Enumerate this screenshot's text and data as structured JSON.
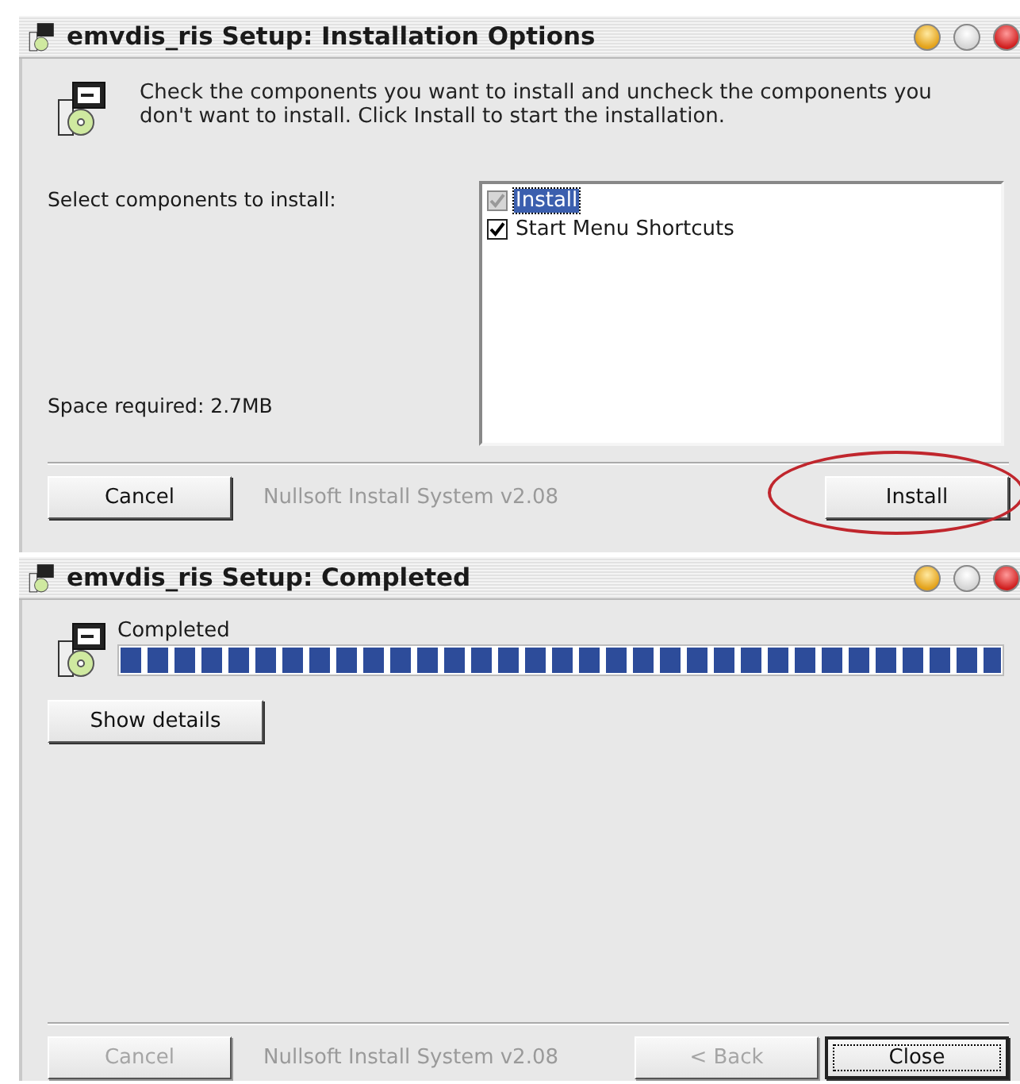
{
  "windows": [
    {
      "kind": "options",
      "title": "emvdis_ris Setup: Installation Options",
      "description": "Check the components you want to install and uncheck the components you don't want to install. Click Install to start the installation.",
      "select_label": "Select components to install:",
      "space_required": "Space required: 2.7MB",
      "components": [
        {
          "label": "Install",
          "checked": true,
          "disabled": true,
          "selected": true
        },
        {
          "label": "Start Menu Shortcuts",
          "checked": true,
          "disabled": false,
          "selected": false
        }
      ],
      "branding": "Nullsoft Install System v2.08",
      "left_buttons": [
        {
          "label": "Cancel",
          "disabled": false,
          "default": false,
          "circled": false
        }
      ],
      "right_buttons": [
        {
          "label": "Install",
          "disabled": false,
          "default": false,
          "circled": true
        }
      ]
    },
    {
      "kind": "progress",
      "title": "emvdis_ris Setup: Completed",
      "status": "Completed",
      "progress": {
        "level": 1
      },
      "details_button": "Show details",
      "branding": "Nullsoft Install System v2.08",
      "left_buttons": [
        {
          "label": "Cancel",
          "disabled": true,
          "default": false,
          "circled": false
        }
      ],
      "right_buttons": [
        {
          "label": "< Back",
          "disabled": true,
          "default": false,
          "circled": false
        },
        {
          "label": "Close",
          "disabled": false,
          "default": true,
          "circled": false
        }
      ]
    }
  ]
}
